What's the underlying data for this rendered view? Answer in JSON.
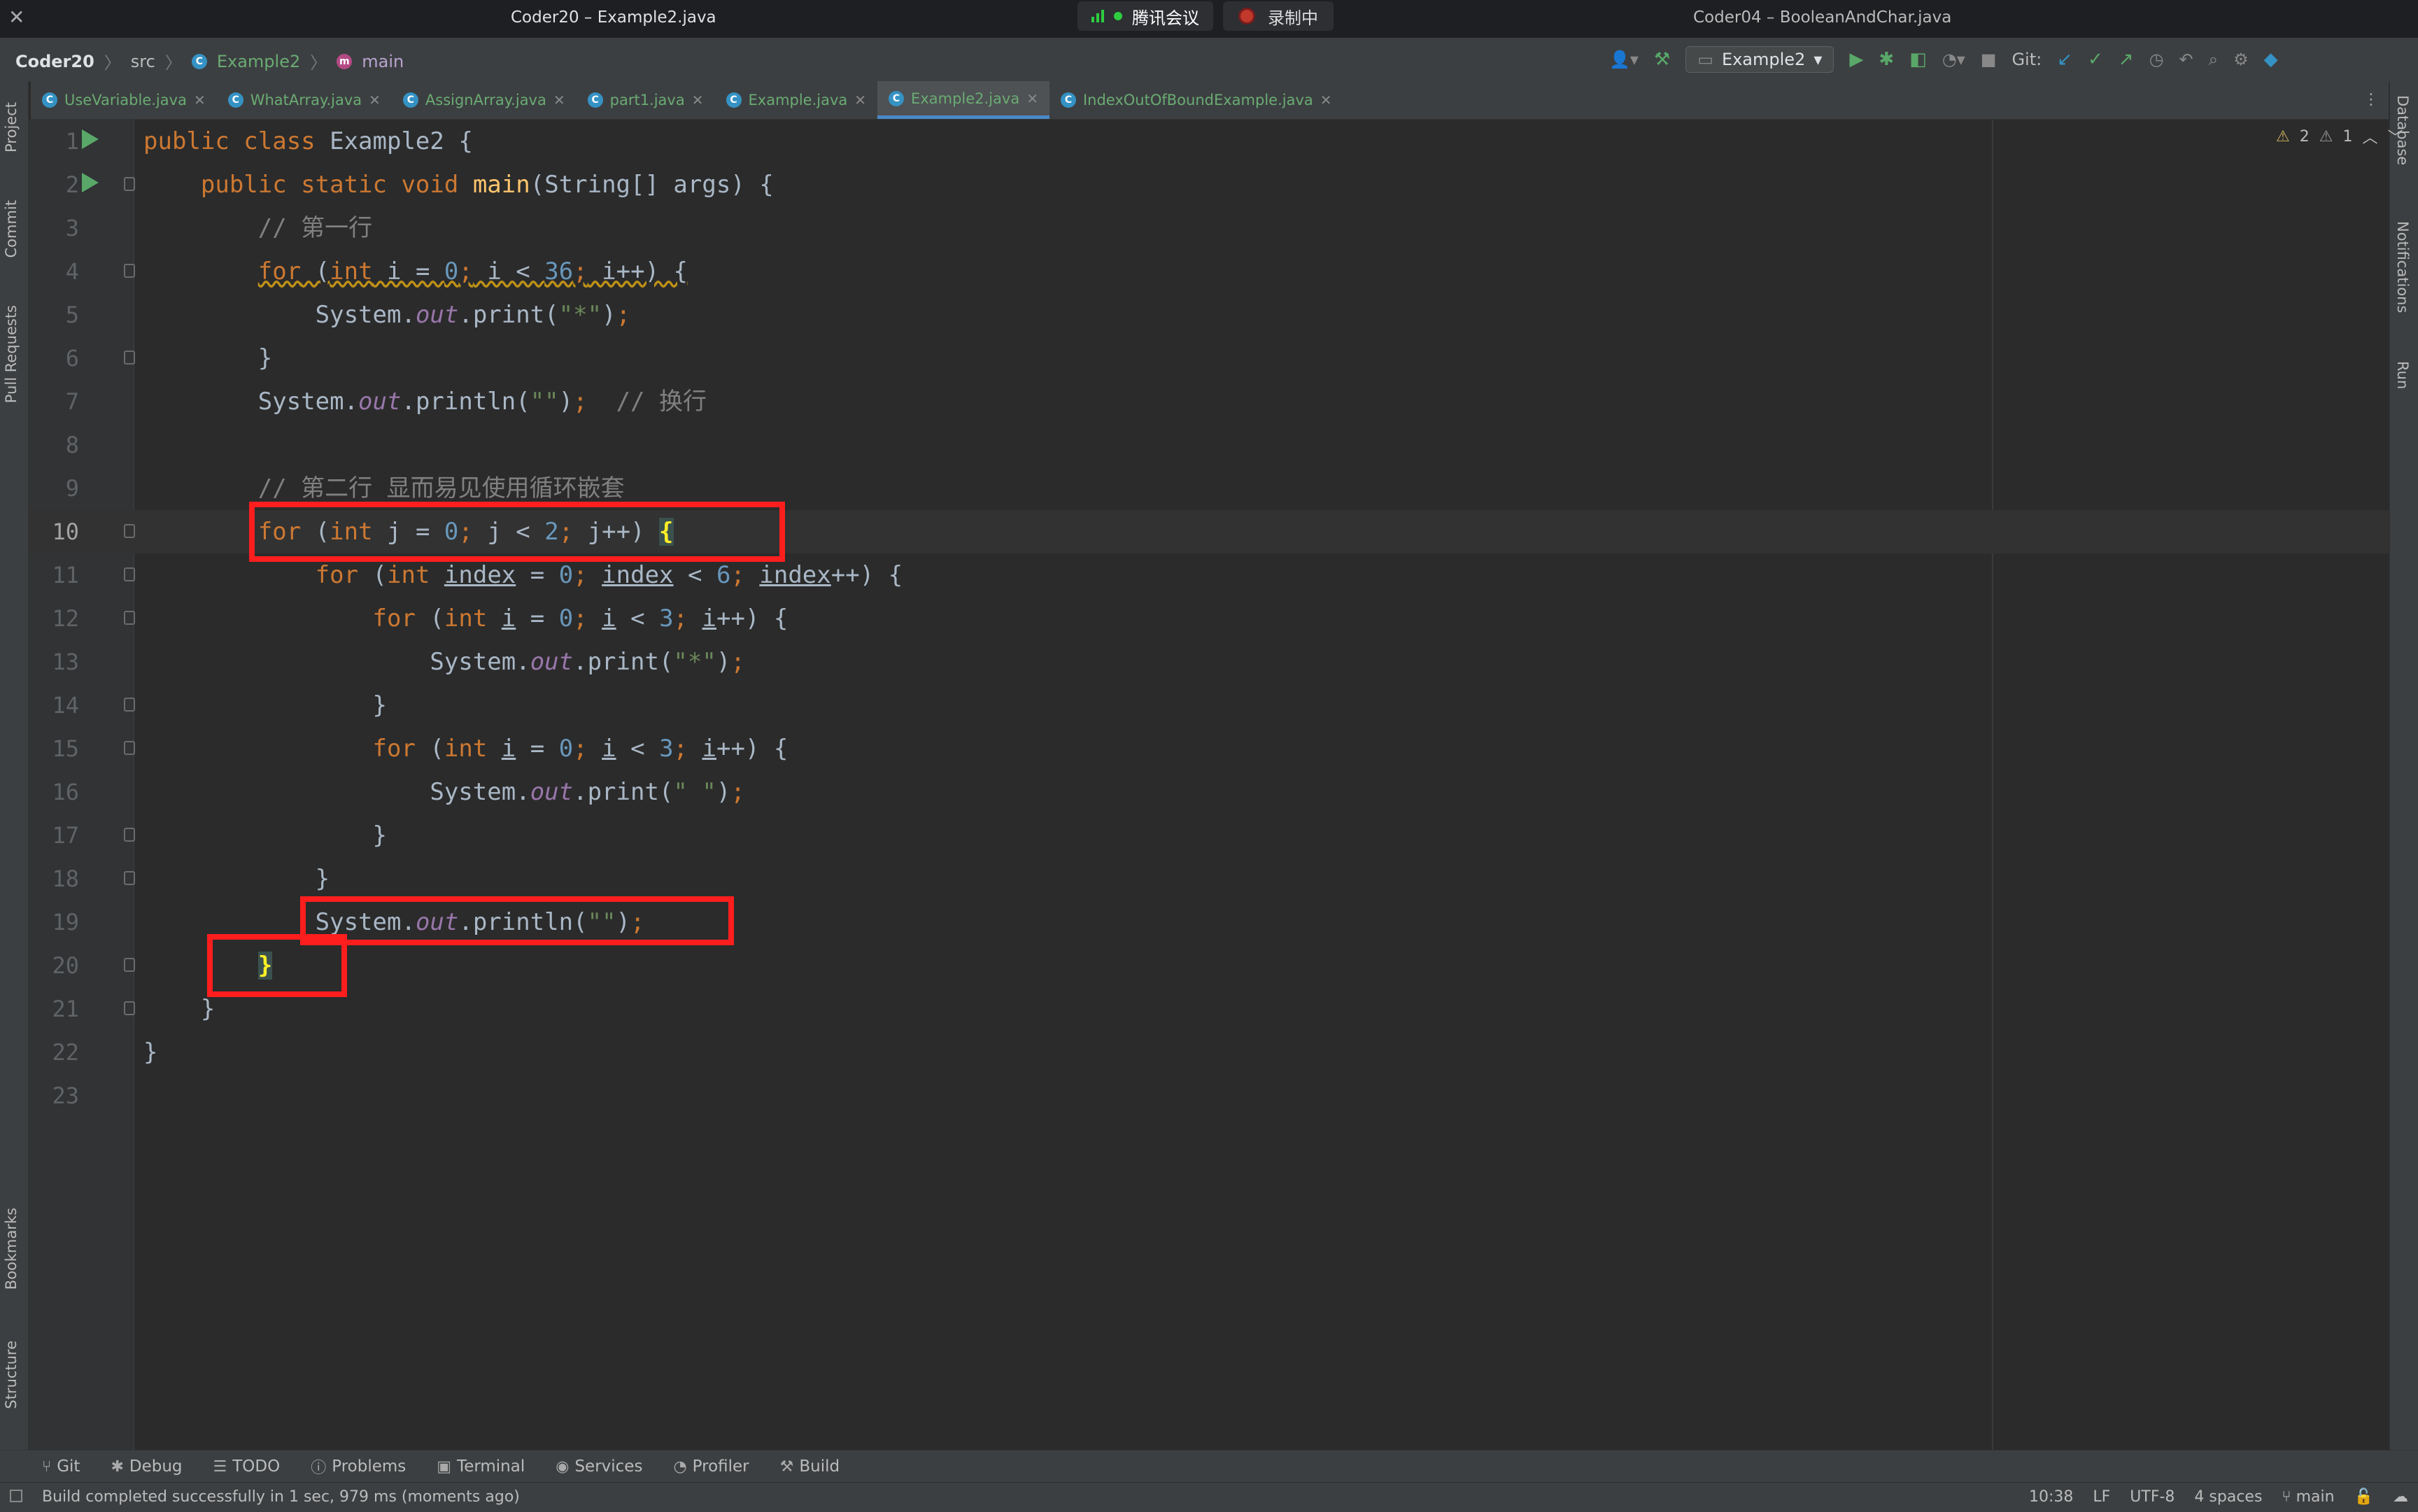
{
  "window": {
    "title_left": "Coder20 – Example2.java",
    "title_right": "Coder04 – BooleanAndChar.java",
    "meeting_app": "腾讯会议",
    "recording": "录制中"
  },
  "breadcrumb": {
    "project": "Coder20",
    "folder": "src",
    "class": "Example2",
    "method": "main"
  },
  "toolbar": {
    "run_config": "Example2",
    "git_label": "Git:"
  },
  "tabs": [
    {
      "label": "UseVariable.java"
    },
    {
      "label": "WhatArray.java"
    },
    {
      "label": "AssignArray.java"
    },
    {
      "label": "part1.java"
    },
    {
      "label": "Example.java"
    },
    {
      "label": "Example2.java",
      "active": true
    },
    {
      "label": "IndexOutOfBoundExample.java"
    }
  ],
  "left_tools": [
    "Project",
    "Commit",
    "Pull Requests",
    "Bookmarks",
    "Structure"
  ],
  "right_tools": [
    "Database",
    "Notifications",
    "Run"
  ],
  "inspections": {
    "warnings": "2",
    "weak_warnings": "1"
  },
  "editor": {
    "current_line": 10,
    "lines": [
      {
        "n": "1",
        "code": "public class Example2 {"
      },
      {
        "n": "2",
        "code": "    public static void main(String[] args) {"
      },
      {
        "n": "3",
        "code": "        // 第一行"
      },
      {
        "n": "4",
        "code": "        for (int i = 0; i < 36; i++) {"
      },
      {
        "n": "5",
        "code": "            System.out.print(\"*\");"
      },
      {
        "n": "6",
        "code": "        }"
      },
      {
        "n": "7",
        "code": "        System.out.println(\"\");  // 换行"
      },
      {
        "n": "8",
        "code": ""
      },
      {
        "n": "9",
        "code": "        // 第二行 显而易见使用循环嵌套"
      },
      {
        "n": "10",
        "code": "        for (int j = 0; j < 2; j++) {"
      },
      {
        "n": "11",
        "code": "            for (int index = 0; index < 6; index++) {"
      },
      {
        "n": "12",
        "code": "                for (int i = 0; i < 3; i++) {"
      },
      {
        "n": "13",
        "code": "                    System.out.print(\"*\");"
      },
      {
        "n": "14",
        "code": "                }"
      },
      {
        "n": "15",
        "code": "                for (int i = 0; i < 3; i++) {"
      },
      {
        "n": "16",
        "code": "                    System.out.print(\" \");"
      },
      {
        "n": "17",
        "code": "                }"
      },
      {
        "n": "18",
        "code": "            }"
      },
      {
        "n": "19",
        "code": "            System.out.println(\"\");"
      },
      {
        "n": "20",
        "code": "        }"
      },
      {
        "n": "21",
        "code": "    }"
      },
      {
        "n": "22",
        "code": "}"
      },
      {
        "n": "23",
        "code": ""
      }
    ]
  },
  "bottom_tools": [
    "Git",
    "Debug",
    "TODO",
    "Problems",
    "Terminal",
    "Services",
    "Profiler",
    "Build"
  ],
  "status": {
    "message": "Build completed successfully in 1 sec, 979 ms (moments ago)",
    "position": "10:38",
    "line_sep": "LF",
    "encoding": "UTF-8",
    "indent": "4 spaces",
    "branch": "main"
  },
  "colors": {
    "keyword": "#cc7832",
    "number": "#6897bb",
    "string": "#6a8759",
    "comment": "#808080",
    "method": "#ffc66d",
    "field": "#9876aa",
    "annotation_box": "#ff1e1e"
  }
}
